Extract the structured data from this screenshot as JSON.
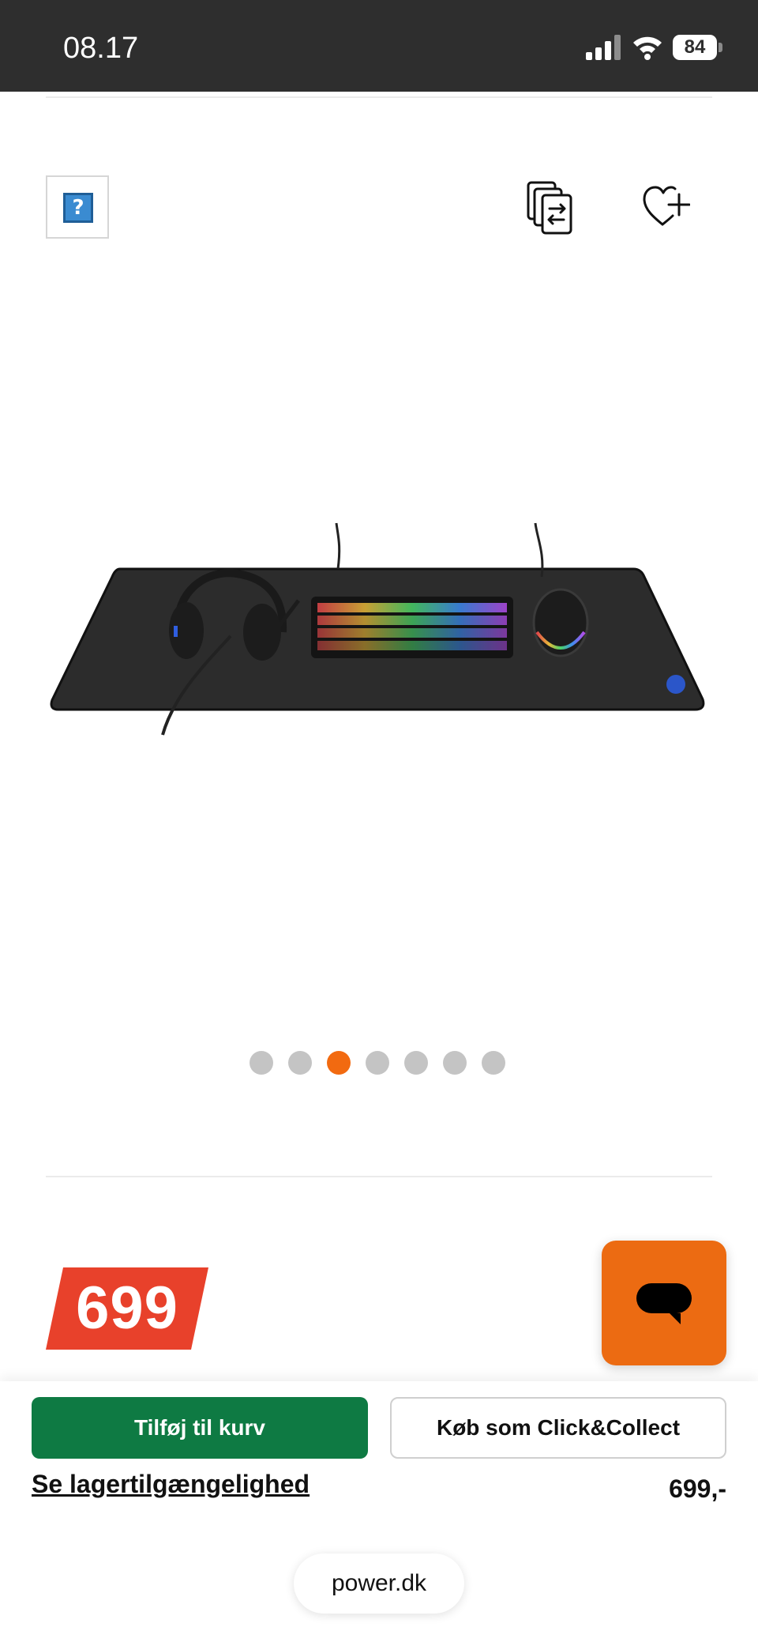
{
  "status_bar": {
    "time": "08.17",
    "battery": "84",
    "icons": [
      "signal-icon",
      "wifi-icon",
      "battery-icon"
    ]
  },
  "toolbar": {
    "icons": [
      "help-icon",
      "compare-icon",
      "wishlist-add-icon"
    ],
    "help_glyph": "?"
  },
  "product": {
    "image": "gaming-desk-setup-image",
    "carousel": {
      "total": 7,
      "active_index": 2
    }
  },
  "price": {
    "badge": "699"
  },
  "actions": {
    "add_to_cart": "Tilføj til kurv",
    "click_collect": "Køb som Click&Collect",
    "stock_link": "Se lagertilgængelighed",
    "price": "699,-"
  },
  "browser": {
    "url": "power.dk"
  },
  "colors": {
    "accent_orange": "#f26a10",
    "price_red": "#e8412b",
    "cart_green": "#0e7a43",
    "status_bar": "#2e2e2e"
  }
}
